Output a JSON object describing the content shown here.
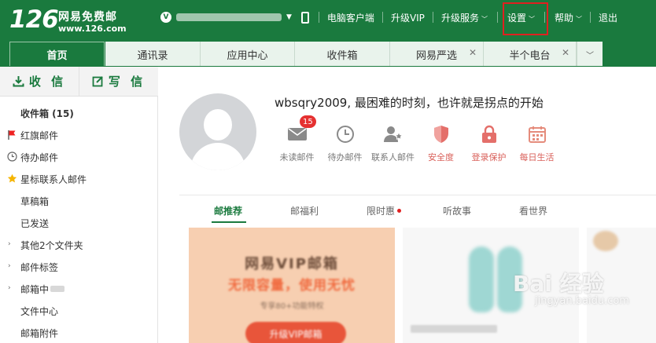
{
  "colors": {
    "brand_green": "#1a7a3e",
    "tab_bg": "#e9f3ec",
    "alert_red": "#e53131",
    "highlight_box": "#e02020"
  },
  "header": {
    "logo_number": "126",
    "logo_name": "网易免费邮",
    "logo_url": "www.126.com",
    "nav": {
      "desktop_client": "电脑客户端",
      "upgrade_vip": "升级VIP",
      "upgrade_service": "升级服务",
      "settings": "设置",
      "help": "帮助",
      "logout": "退出"
    }
  },
  "tabs": [
    {
      "label": "首页",
      "active": true
    },
    {
      "label": "通讯录"
    },
    {
      "label": "应用中心"
    },
    {
      "label": "收件箱"
    },
    {
      "label": "网易严选",
      "closable": true
    },
    {
      "label": "半个电台",
      "closable": true
    }
  ],
  "sidebar": {
    "receive": "收 信",
    "compose": "写 信",
    "folders": {
      "inbox": "收件箱 (15)",
      "red_flag": "红旗邮件",
      "todo": "待办邮件",
      "star_contacts": "星标联系人邮件",
      "drafts": "草稿箱",
      "sent": "已发送",
      "other": "其他2个文件夹",
      "labels": "邮件标签",
      "mailbox_center": "邮箱中",
      "file_center": "文件中心",
      "attachments": "邮箱附件"
    }
  },
  "main": {
    "greeting": "wbsqry2009,  最困难的时刻，也许就是拐点的开始",
    "quick": {
      "unread": "未读邮件",
      "unread_count": "15",
      "todo": "待办邮件",
      "contacts": "联系人邮件",
      "security": "安全度",
      "login_protect": "登录保护",
      "daily_life": "每日生活"
    },
    "feed_tabs": {
      "recommend": "邮推荐",
      "welfare": "邮福利",
      "limited": "限时惠",
      "stories": "听故事",
      "world": "看世界"
    },
    "card_vip": {
      "title": "网易VIP邮箱",
      "subtitle": "无限容量，使用无忧",
      "note": "专享80+功能特权",
      "button": "升级VIP邮箱"
    }
  },
  "watermark": {
    "brand": "Bai 经验",
    "url": "jingyan.baidu.com"
  }
}
